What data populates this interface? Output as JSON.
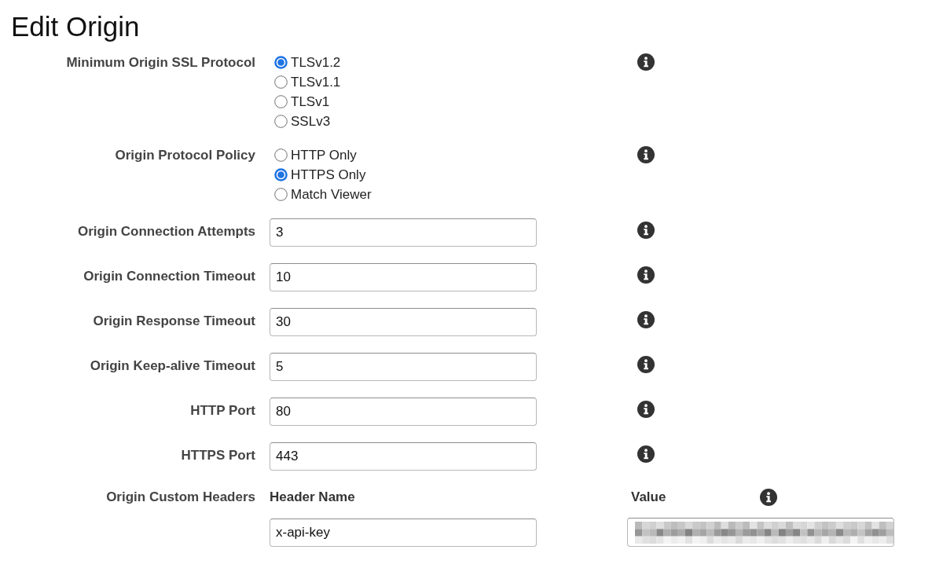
{
  "title": "Edit Origin",
  "fields": [
    {
      "kind": "radio",
      "label": "Minimum Origin SSL Protocol",
      "options": [
        {
          "label": "TLSv1.2",
          "selected": true
        },
        {
          "label": "TLSv1.1",
          "selected": false
        },
        {
          "label": "TLSv1",
          "selected": false
        },
        {
          "label": "SSLv3",
          "selected": false
        }
      ]
    },
    {
      "kind": "radio",
      "label": "Origin Protocol Policy",
      "options": [
        {
          "label": "HTTP Only",
          "selected": false
        },
        {
          "label": "HTTPS Only",
          "selected": true
        },
        {
          "label": "Match Viewer",
          "selected": false
        }
      ]
    },
    {
      "kind": "text",
      "label": "Origin Connection Attempts",
      "value": "3"
    },
    {
      "kind": "text",
      "label": "Origin Connection Timeout",
      "value": "10"
    },
    {
      "kind": "text",
      "label": "Origin Response Timeout",
      "value": "30"
    },
    {
      "kind": "text",
      "label": "Origin Keep-alive Timeout",
      "value": "5"
    },
    {
      "kind": "text",
      "label": "HTTP Port",
      "value": "80"
    },
    {
      "kind": "text",
      "label": "HTTPS Port",
      "value": "443"
    }
  ],
  "custom_headers": {
    "label": "Origin Custom Headers",
    "columns": [
      "Header Name",
      "Value"
    ],
    "rows": [
      {
        "name": "x-api-key",
        "value_redacted": true
      }
    ]
  }
}
